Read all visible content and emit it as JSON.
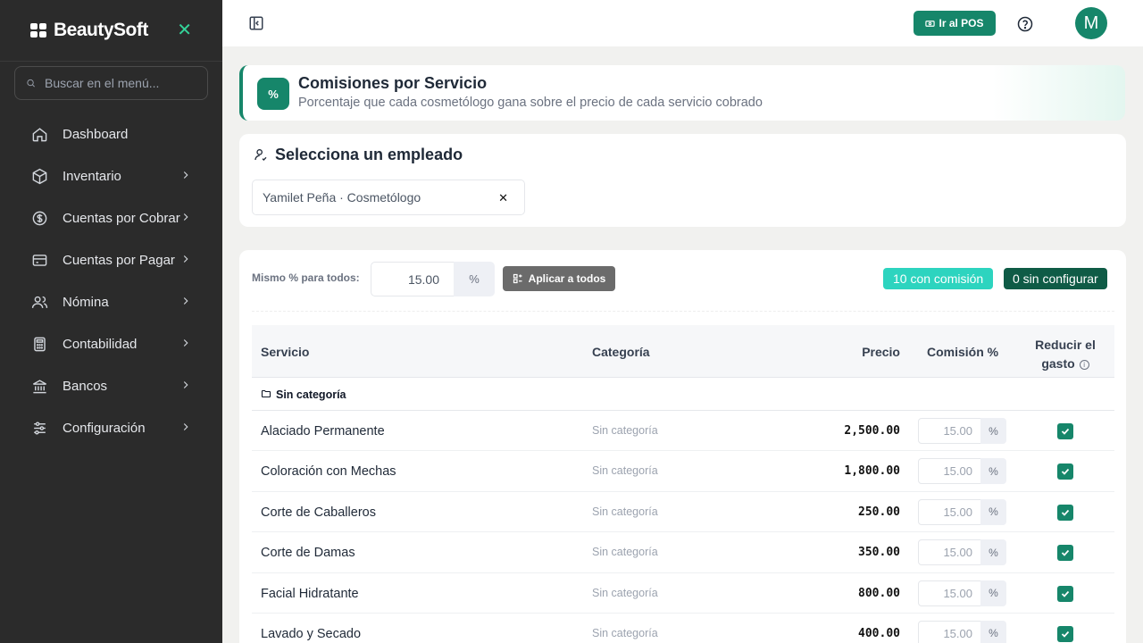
{
  "app": {
    "brand": "BeautySoft",
    "search_placeholder": "Buscar en el menú...",
    "accent": "#16866a"
  },
  "sidebar": {
    "items": [
      {
        "label": "Dashboard",
        "icon": "home-icon",
        "has_chevron": false
      },
      {
        "label": "Inventario",
        "icon": "box-icon",
        "has_chevron": true
      },
      {
        "label": "Cuentas por Cobrar",
        "icon": "dollar-circle-icon",
        "has_chevron": true
      },
      {
        "label": "Cuentas por Pagar",
        "icon": "credit-card-icon",
        "has_chevron": true
      },
      {
        "label": "Nómina",
        "icon": "users-icon",
        "has_chevron": true
      },
      {
        "label": "Contabilidad",
        "icon": "calculator-icon",
        "has_chevron": true
      },
      {
        "label": "Bancos",
        "icon": "bank-icon",
        "has_chevron": true
      },
      {
        "label": "Configuración",
        "icon": "sliders-icon",
        "has_chevron": true
      }
    ]
  },
  "topbar": {
    "pos_label": "Ir al POS",
    "avatar_initial": "M"
  },
  "header": {
    "title": "Comisiones por Servicio",
    "subtitle": "Porcentaje que cada cosmetólogo gana sobre el precio de cada servicio cobrado"
  },
  "employee": {
    "title": "Selecciona un empleado",
    "selected": "Yamilet Peña · Cosmetólogo"
  },
  "bulk": {
    "label": "Mismo % para todos:",
    "value": "15.00",
    "unit": "%",
    "apply_label": "Aplicar a todos",
    "badge_with": "10 con comisión",
    "badge_without": "0 sin configurar"
  },
  "table": {
    "columns": {
      "service": "Servicio",
      "category": "Categoría",
      "price": "Precio",
      "commission": "Comisión %",
      "reduce": "Reducir el gasto"
    },
    "group_label": "Sin categoría",
    "rows": [
      {
        "service": "Alaciado Permanente",
        "category": "Sin categoría",
        "price": "2,500.00",
        "commission": "15.00",
        "reduce": true
      },
      {
        "service": "Coloración con Mechas",
        "category": "Sin categoría",
        "price": "1,800.00",
        "commission": "15.00",
        "reduce": true
      },
      {
        "service": "Corte de Caballeros",
        "category": "Sin categoría",
        "price": "250.00",
        "commission": "15.00",
        "reduce": true
      },
      {
        "service": "Corte de Damas",
        "category": "Sin categoría",
        "price": "350.00",
        "commission": "15.00",
        "reduce": true
      },
      {
        "service": "Facial Hidratante",
        "category": "Sin categoría",
        "price": "800.00",
        "commission": "15.00",
        "reduce": true
      },
      {
        "service": "Lavado y Secado",
        "category": "Sin categoría",
        "price": "400.00",
        "commission": "15.00",
        "reduce": true
      }
    ]
  }
}
